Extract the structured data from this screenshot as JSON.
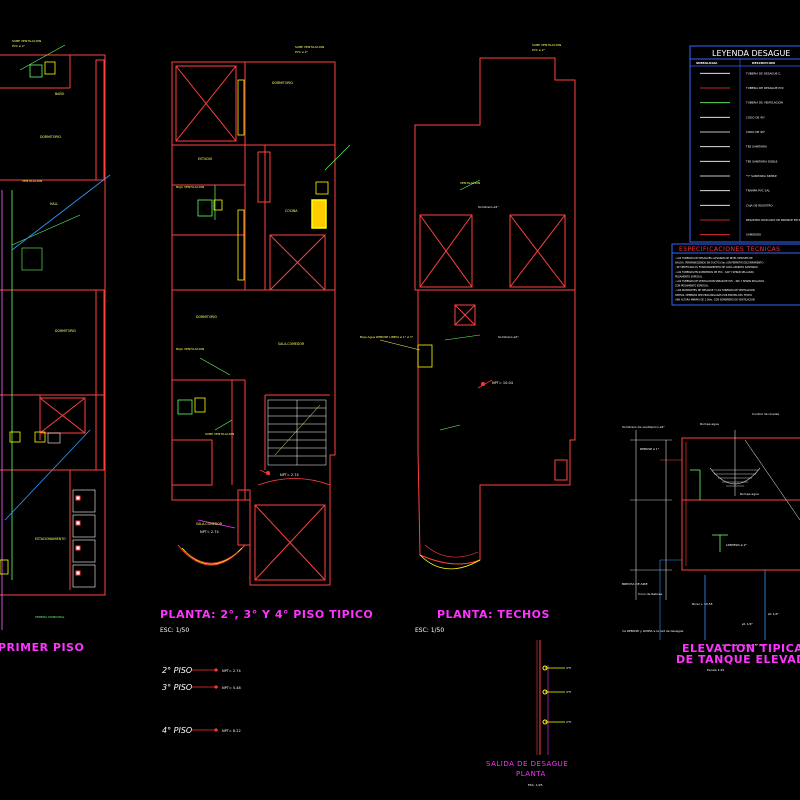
{
  "plans": {
    "primer_piso": {
      "title": "PRIMER  PISO"
    },
    "tipico": {
      "title": "PLANTA: 2°, 3° Y 4° PISO TIPICO",
      "scale": "ESC: 1/50"
    },
    "techos": {
      "title": "PLANTA: TECHOS",
      "scale": "ESC: 1/50"
    },
    "elevacion": {
      "title_line1": "ELEVACION TIPICA",
      "title_line2": "DE TANQUE ELEVADO",
      "scale": "Escala 1:25"
    }
  },
  "rooms": {
    "p1_bano": "BAÑO",
    "p1_dormitorio1": "DORMITORIO",
    "p1_hall": "HALL",
    "p1_dormitorio2": "DORMITORIO",
    "p1_estacionamiento": "ESTACIONAMIENTO",
    "p1_vereda": "VEREDA MUNICIPAL",
    "t_dormitorio": "DORMITORIO",
    "t_estudio": "ESTUDIO",
    "t_cocina": "COCINA",
    "t_dormitorio2": "DORMITORIO",
    "t_sala_comedor": "SALA-COMEDOR",
    "t_sala_comedor2": "SALA-COMEDOR"
  },
  "labels": {
    "sube_ventilacion": "SUBE VENTILACION",
    "pvc": "PVC ø 2\"",
    "baja_vent": "BAJA VENTILACION",
    "sombrero": "Sombrero ø2\"",
    "sombrero2": "Sombrero ø2\"",
    "ventilacion": "VENTILACION",
    "npt_techo": "NPT= 10.04",
    "npt_tipico": "NPT= 2.74",
    "npt_sala": "NPT= 2.74",
    "baja_agua": "Baja Agua REBOSE LIMPIA ø 1\" ø 3\"",
    "sombrero_vent": "Sombrero de ventilacion ø2\"",
    "rebose": "REBOSE ø 1\"",
    "rompe_agua": "Rompe agua",
    "control_nivel": "Control de niveles",
    "limpieza": "LIMPIEZA ø 2\"",
    "brecha": "BRECHA DE AIRE",
    "cono": "Cono de Rebose",
    "nivel": "Nivel + 10.55",
    "rebose_limpia": "ira REBOSE y LIMPIA a la red de desagüe",
    "alimentador": "Alimentador de Agua FF (L)",
    "valvula": "ø1 1/4\"",
    "valvula2": "ø1 1/4\""
  },
  "floors": [
    {
      "label": "2° PISO",
      "npt": "NPT= 2.74"
    },
    {
      "label": "3° PISO",
      "npt": "NPT= 5.48"
    },
    {
      "label": "4° PISO",
      "npt": "NPT= 8.22"
    }
  ],
  "riser_labels": [
    "4°P",
    "3°P",
    "2°P"
  ],
  "salida": {
    "line1": "SALIDA  DE  DESAGUE",
    "line2": "PLANTA",
    "scale": "ESC. 1/25"
  },
  "legend": {
    "title": "LEYENDA DESAGUE",
    "col_symbol": "SIMBOLOGIA",
    "col_desc": "DESCRIPCION",
    "rows": [
      "TUBERIA DE DESAGUE C.",
      "TUBERIA DE DESAGUE PVC",
      "TUBERIA DE VENTILACION",
      "CODO DE 45°",
      "CODO DE 90°",
      "TEE SANITARIA",
      "TEE SANITARIA DOBLE",
      "\"Y\" SANITARIA SIMPLE",
      "TRAMPA PVC SAL",
      "CAJA DE REGISTRO",
      "REGISTRO ROSCADO DE BRONCE EN PISO",
      "SUMIDERO"
    ]
  },
  "specs": {
    "title": "ESPECIFICACIONES TECNICAS",
    "lines": [
      "- LAS TUBERIAS DE DESAGUES LLEVARAN DE NIVEL DESPUES DE",
      "  SALIDA, PERMANECIENDO EN DUCTO (Ver.) EN PERMITIR ESCURRIMIENTO",
      "- SE VERIFICARA EL FUNCIONAMIENTO DE CADA APARATO SANITARIO",
      "- LAS TUBERIAS EN SUMIDEROS DE PVC - SAP Y SERAN SELLADAS",
      "  PEGAMENTO ESPECIAL",
      "- LAS TUBERIAS DE VENTILACION SERAN DE PVC - SEL Y SERAN SELLADAS",
      "  CON PEGAMENTO ESPECIAL",
      "- LOS MONTANTES DE DESAGUE Y LAS TUBERIAS DE VENTILACION",
      "  CERTAS, DEBERAN SER PROLONGADAS POR ENCIMA DEL TECHO",
      "  UNA ALTURA MINIMA DE 1.00m, CON SOMBRERO DE VENTILACION"
    ]
  }
}
